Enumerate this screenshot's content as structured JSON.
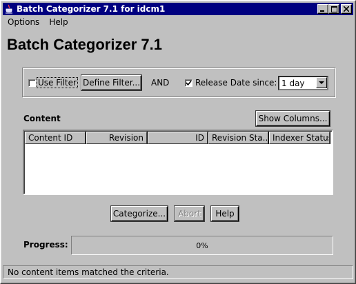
{
  "window": {
    "title": "Batch Categorizer 7.1 for idcm1",
    "controls": [
      "minimize",
      "maximize",
      "close"
    ],
    "title_icon": "java-cup-icon"
  },
  "menu": {
    "items": [
      {
        "label": "Options"
      },
      {
        "label": "Help"
      }
    ]
  },
  "heading": "Batch Categorizer 7.1",
  "filter": {
    "use_filter_label": "Use Filter",
    "use_filter_checked": false,
    "define_filter_label": "Define Filter...",
    "and_label": "AND",
    "release_date_label": "Release Date since:",
    "release_date_checked": true,
    "release_date_value": "1 day"
  },
  "content": {
    "section_label": "Content",
    "show_columns_label": "Show Columns...",
    "columns": [
      {
        "label": "Content ID"
      },
      {
        "label": "Revision"
      },
      {
        "label": "ID"
      },
      {
        "label": "Revision Sta..."
      },
      {
        "label": "Indexer Status"
      }
    ],
    "rows": []
  },
  "actions": {
    "categorize_label": "Categorize...",
    "abort_label": "Abort",
    "abort_enabled": false,
    "help_label": "Help"
  },
  "progress": {
    "label": "Progress:",
    "value": 0,
    "text": "0%"
  },
  "status": {
    "message": "No content items matched the criteria."
  },
  "colors": {
    "title_bar": "#000080",
    "face": "#c0c0c0"
  }
}
